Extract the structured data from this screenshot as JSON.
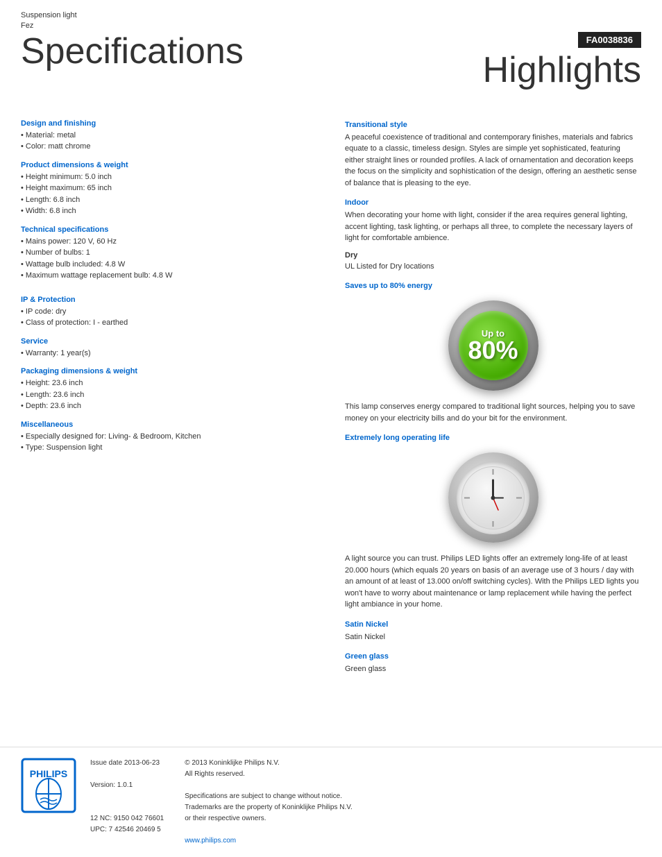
{
  "header": {
    "product_type": "Suspension light",
    "product_model": "Fez",
    "product_code": "FA0038836",
    "page_title": "Specifications",
    "highlights_title": "Highlights"
  },
  "specs": {
    "design_finishing": {
      "title": "Design and finishing",
      "items": [
        "Material: metal",
        "Color: matt chrome"
      ]
    },
    "product_dimensions": {
      "title": "Product dimensions & weight",
      "items": [
        "Height minimum: 5.0 inch",
        "Height maximum: 65 inch",
        "Length: 6.8 inch",
        "Width: 6.8 inch"
      ]
    },
    "technical": {
      "title": "Technical specifications",
      "items": [
        "Mains power: 120 V, 60 Hz",
        "Number of bulbs: 1",
        "Wattage bulb included: 4.8 W",
        "Maximum wattage replacement bulb: 4.8 W"
      ]
    },
    "ip_protection": {
      "title": "IP & Protection",
      "items": [
        "IP code: dry",
        "Class of protection: I - earthed"
      ]
    },
    "service": {
      "title": "Service",
      "items": [
        "Warranty: 1 year(s)"
      ]
    },
    "packaging": {
      "title": "Packaging dimensions & weight",
      "items": [
        "Height: 23.6 inch",
        "Length: 23.6 inch",
        "Depth: 23.6 inch"
      ]
    },
    "miscellaneous": {
      "title": "Miscellaneous",
      "items": [
        "Especially designed for: Living- & Bedroom, Kitchen",
        "Type: Suspension light"
      ]
    }
  },
  "highlights": {
    "transitional_style": {
      "title": "Transitional style",
      "text": "A peaceful coexistence of traditional and contemporary finishes, materials and fabrics equate to a classic, timeless design. Styles are simple yet sophisticated, featuring either straight lines or rounded profiles. A lack of ornamentation and decoration keeps the focus on the simplicity and sophistication of the design, offering an aesthetic sense of balance that is pleasing to the eye."
    },
    "indoor": {
      "title": "Indoor",
      "text": "When decorating your home with light, consider if the area requires general lighting, accent lighting, task lighting, or perhaps all three, to complete the necessary layers of light for comfortable ambience."
    },
    "dry": {
      "title": "Dry",
      "text": "UL Listed for Dry locations"
    },
    "energy": {
      "title": "Saves up to 80% energy",
      "badge_up_to": "Up to",
      "badge_percent": "80%",
      "text": "This lamp conserves energy compared to traditional light sources, helping you to save money on your electricity bills and do your bit for the environment."
    },
    "operating_life": {
      "title": "Extremely long operating life",
      "text": "A light source you can trust. Philips LED lights offer an extremely long-life of at least 20.000 hours (which equals 20 years on basis of an average use of 3 hours / day with an amount of at least of 13.000 on/off switching cycles). With the Philips LED lights you won't have to worry about maintenance or lamp replacement while having the perfect light ambiance in your home."
    },
    "satin_nickel": {
      "title": "Satin Nickel",
      "text": "Satin Nickel"
    },
    "green_glass": {
      "title": "Green glass",
      "text": "Green glass"
    }
  },
  "footer": {
    "issue_date_label": "Issue date 2013-06-23",
    "version_label": "Version: 1.0.1",
    "nc_upc": "12 NC: 9150 042 76601\nUPC: 7 42546 20469 5",
    "copyright": "© 2013 Koninklijke Philips N.V.\nAll Rights reserved.",
    "disclaimer": "Specifications are subject to change without notice.\nTrademarks are the property of Koninklijke Philips N.V.\nor their respective owners.",
    "website": "www.philips.com"
  }
}
